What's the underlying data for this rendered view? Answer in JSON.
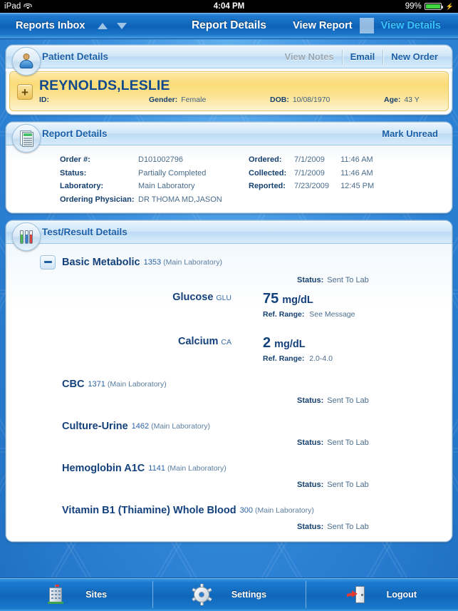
{
  "status_bar": {
    "device": "iPad",
    "wifi_icon": "wifi-icon",
    "time": "4:04 PM",
    "battery_percent": "99%",
    "battery_icon": "battery-icon",
    "charging_icon": "lightning-bolt-icon"
  },
  "nav_bar": {
    "back_label": "Reports Inbox",
    "up_arrow_icon": "triangle-up-icon",
    "down_arrow_icon": "triangle-down-icon",
    "title": "Report Details",
    "view_report_label": "View Report",
    "view_details_label": "View Details",
    "active_segment": "View Details",
    "active_color": "#3cc3ff"
  },
  "patient_panel": {
    "icon": "person-icon",
    "title": "Patient Details",
    "actions": [
      {
        "label": "View Notes",
        "disabled": true
      },
      {
        "label": "Email",
        "disabled": false
      },
      {
        "label": "New Order",
        "disabled": false
      }
    ],
    "expand_icon": "plus-icon",
    "name": "REYNOLDS,LESLIE",
    "fields": [
      {
        "key": "ID:",
        "value": ""
      },
      {
        "key": "Gender:",
        "value": "Female"
      },
      {
        "key": "DOB:",
        "value": "10/08/1970"
      },
      {
        "key": "Age:",
        "value": "43 Y"
      }
    ]
  },
  "report_panel": {
    "icon": "report-document-icon",
    "title": "Report Details",
    "mark_unread_label": "Mark Unread",
    "left_fields": [
      {
        "key": "Order #:",
        "value": "D101002796"
      },
      {
        "key": "Status:",
        "value": "Partially Completed"
      },
      {
        "key": "Laboratory:",
        "value": "Main Laboratory"
      },
      {
        "key": "Ordering Physician:",
        "value": "DR THOMA MD,JASON"
      }
    ],
    "right_fields": [
      {
        "key": "Ordered:",
        "date": "7/1/2009",
        "time": "11:46 AM"
      },
      {
        "key": "Collected:",
        "date": "7/1/2009",
        "time": "11:46 AM"
      },
      {
        "key": "Reported:",
        "date": "7/23/2009",
        "time": "12:45 PM"
      }
    ]
  },
  "test_panel": {
    "icon": "test-tubes-icon",
    "title": "Test/Result Details",
    "status_key": "Status:",
    "ref_range_key": "Ref. Range:",
    "collapse_icon": "minus-icon",
    "tests": [
      {
        "name": "Basic Metabolic",
        "number": "1353",
        "lab": "(Main Laboratory)",
        "status": "Sent To Lab",
        "expanded": true,
        "analytes": [
          {
            "name": "Glucose",
            "abbr": "GLU",
            "value": "75",
            "unit": "mg/dL",
            "ref_range": "See Message"
          },
          {
            "name": "Calcium",
            "abbr": "CA",
            "value": "2",
            "unit": "mg/dL",
            "ref_range": "2.0-4.0"
          }
        ]
      },
      {
        "name": "CBC",
        "number": "1371",
        "lab": "(Main Laboratory)",
        "status": "Sent To Lab",
        "expanded": false,
        "analytes": []
      },
      {
        "name": "Culture-Urine",
        "number": "1462",
        "lab": "(Main Laboratory)",
        "status": "Sent To Lab",
        "expanded": false,
        "analytes": []
      },
      {
        "name": "Hemoglobin A1C",
        "number": "1141",
        "lab": "(Main Laboratory)",
        "status": "Sent To Lab",
        "expanded": false,
        "analytes": []
      },
      {
        "name": "Vitamin B1 (Thiamine) Whole Blood",
        "number": "300",
        "lab": "(Main Laboratory)",
        "status": "Sent To Lab",
        "expanded": false,
        "analytes": []
      }
    ]
  },
  "tab_bar": {
    "tabs": [
      {
        "label": "Sites",
        "icon": "building-icon"
      },
      {
        "label": "Settings",
        "icon": "gear-icon"
      },
      {
        "label": "Logout",
        "icon": "logout-door-icon"
      }
    ]
  }
}
